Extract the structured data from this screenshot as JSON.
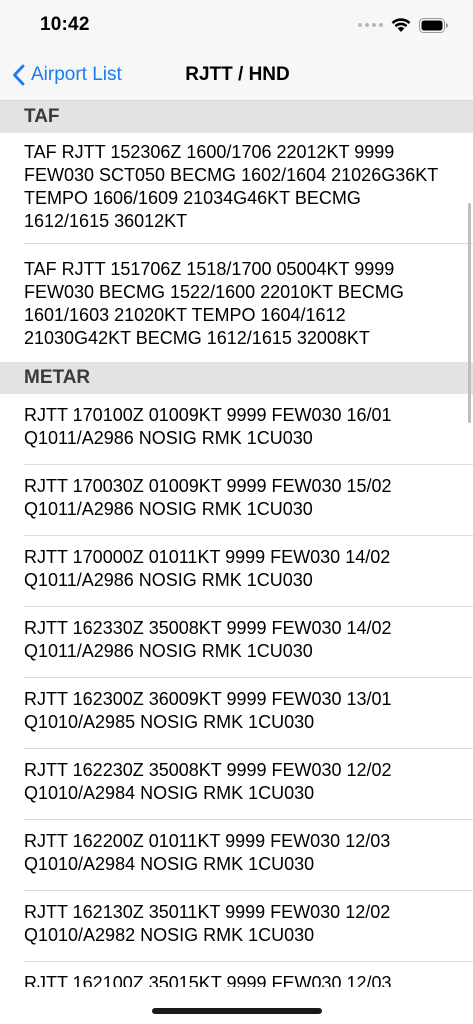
{
  "status_bar": {
    "time": "10:42",
    "icons": [
      "cellular-dots-icon",
      "wifi-icon",
      "battery-icon"
    ]
  },
  "nav": {
    "back_label": "Airport List",
    "title": "RJTT / HND"
  },
  "colors": {
    "accent": "#1a7bf5",
    "section_header_bg": "#e3e3e3",
    "bar_bg": "#f7f7f7"
  },
  "sections": {
    "taf": {
      "header": "TAF",
      "items": [
        "TAF RJTT 152306Z 1600/1706 22012KT 9999 FEW030 SCT050 BECMG 1602/1604 21026G36KT TEMPO 1606/1609 21034G46KT BECMG 1612/1615 36012KT",
        "TAF RJTT 151706Z 1518/1700 05004KT 9999 FEW030 BECMG 1522/1600 22010KT BECMG 1601/1603 21020KT TEMPO 1604/1612 21030G42KT BECMG 1612/1615 32008KT"
      ]
    },
    "metar": {
      "header": "METAR",
      "items": [
        "RJTT 170100Z 01009KT 9999 FEW030 16/01 Q1011/A2986 NOSIG RMK 1CU030",
        "RJTT 170030Z 01009KT 9999 FEW030 15/02 Q1011/A2986 NOSIG RMK 1CU030",
        "RJTT 170000Z 01011KT 9999 FEW030 14/02 Q1011/A2986 NOSIG RMK 1CU030",
        "RJTT 162330Z 35008KT 9999 FEW030 14/02 Q1011/A2986 NOSIG RMK 1CU030",
        "RJTT 162300Z 36009KT 9999 FEW030 13/01 Q1010/A2985 NOSIG RMK 1CU030",
        "RJTT 162230Z 35008KT 9999 FEW030 12/02 Q1010/A2984 NOSIG RMK 1CU030",
        "RJTT 162200Z 01011KT 9999 FEW030 12/03 Q1010/A2984 NOSIG RMK 1CU030",
        "RJTT 162130Z 35011KT 9999 FEW030 12/02 Q1010/A2982 NOSIG RMK 1CU030",
        "RJTT 162100Z 35015KT 9999 FEW030 12/03"
      ]
    }
  }
}
